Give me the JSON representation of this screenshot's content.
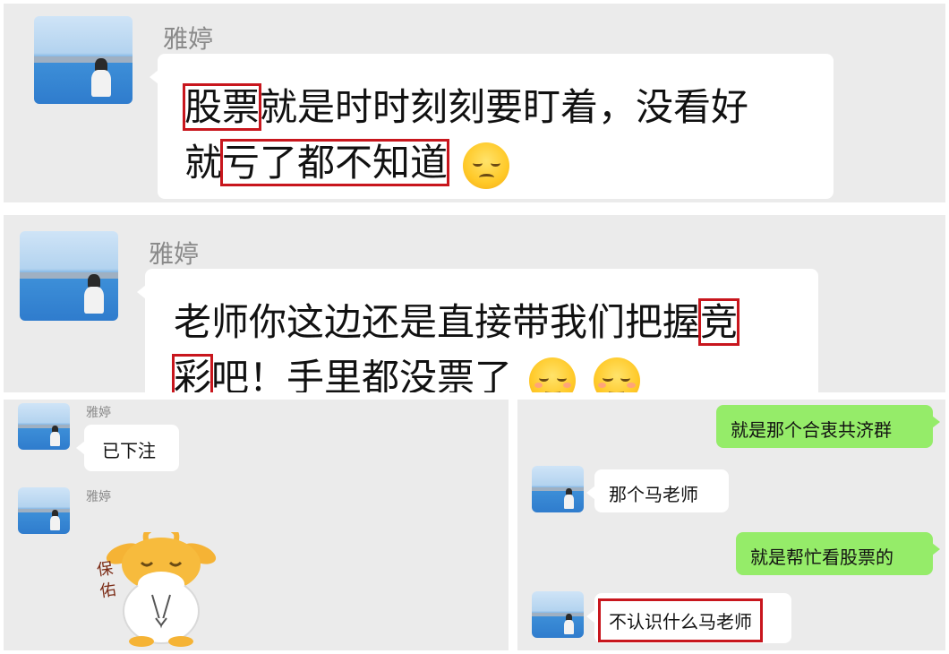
{
  "chat1": {
    "sender": "雅婷",
    "line1_hl": "股票",
    "line1_rest": "就是时时刻刻要盯着，没看好",
    "line2_start": "就",
    "line2_hl": "亏了都不知道",
    "emoji": "pensive-face"
  },
  "chat2": {
    "sender": "雅婷",
    "line1_text": "老师你这边还是直接带我们把握",
    "line1_hl": "竞",
    "line2_hl": "彩",
    "line2_rest": "吧！手里都没票了",
    "emojis": [
      "smiling-face",
      "smiling-face"
    ]
  },
  "chat3": {
    "sender1": "雅婷",
    "message1": "已下注",
    "sender2": "雅婷",
    "sticker_text": "保佑",
    "sticker": "cow-praying-sticker"
  },
  "chat4": {
    "sent1": "就是那个合衷共济群",
    "received1": "那个马老师",
    "sent2": "就是帮忙看股票的",
    "received2": "不认识什么马老师"
  },
  "colors": {
    "highlight_box": "#c8161d",
    "sent_bubble": "#95ec69",
    "chat_background": "#ebebeb"
  }
}
